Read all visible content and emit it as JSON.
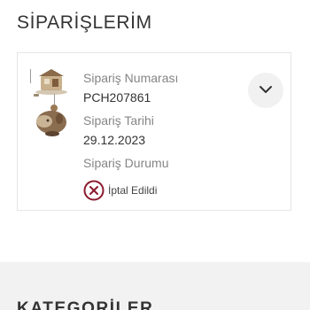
{
  "header": {
    "title": "SİPARİŞLERİM"
  },
  "order": {
    "number_label": "Sipariş Numarası",
    "number_value": "PCH207861",
    "date_label": "Sipariş Tarihi",
    "date_value": "29.12.2023",
    "status_label": "Sipariş Durumu",
    "status_value": "İptal Edildi",
    "status_icon": "cancel-circle-icon",
    "expand_icon": "chevron-down-icon"
  },
  "categories_section": {
    "title": "KATEGORİLER"
  },
  "colors": {
    "text": "#333333",
    "label": "#858585",
    "card_border": "#e6e6e6",
    "band_background": "#f2f2f2",
    "cancel_icon": "#8b1a2e"
  }
}
